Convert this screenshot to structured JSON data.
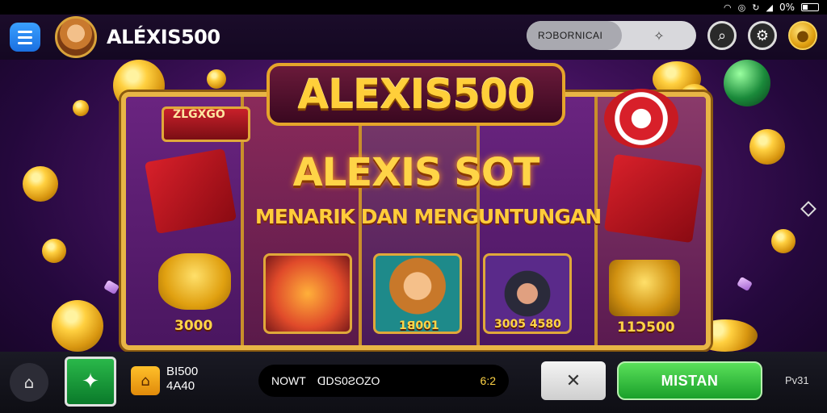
{
  "status_bar": {
    "battery": "0%"
  },
  "header": {
    "username": "ALÉXIS500",
    "promo_label": "RƆBORNICAI",
    "promo_icon": "sparkle-icon",
    "icons": [
      "menu-icon",
      "search-icon",
      "gear-icon",
      "coin-icon"
    ]
  },
  "game": {
    "title": "ALEXIS500",
    "subtitle_main": "ALEXIS SOT",
    "tagline": "MENARIK DAN MENGUNTUNGAN",
    "reel_labels": {
      "red_box": "ZLGXGO",
      "coin_pile": "3000",
      "girl": "1ꓭ001",
      "pirate": "3005 4580",
      "bag": "11Ɔ500"
    }
  },
  "bottom_bar": {
    "balance_line1": "BI500",
    "balance_line2": "4A40",
    "info_left": "NOWT",
    "info_mid": "ꓷDS0ƧOZO",
    "info_right": "6:2",
    "spin_label": "MISTAN",
    "corner_text": "Pv31"
  },
  "colors": {
    "accent_gold": "#ffd447",
    "spin_green": "#1aa02a",
    "menu_blue": "#1a6fe0"
  }
}
